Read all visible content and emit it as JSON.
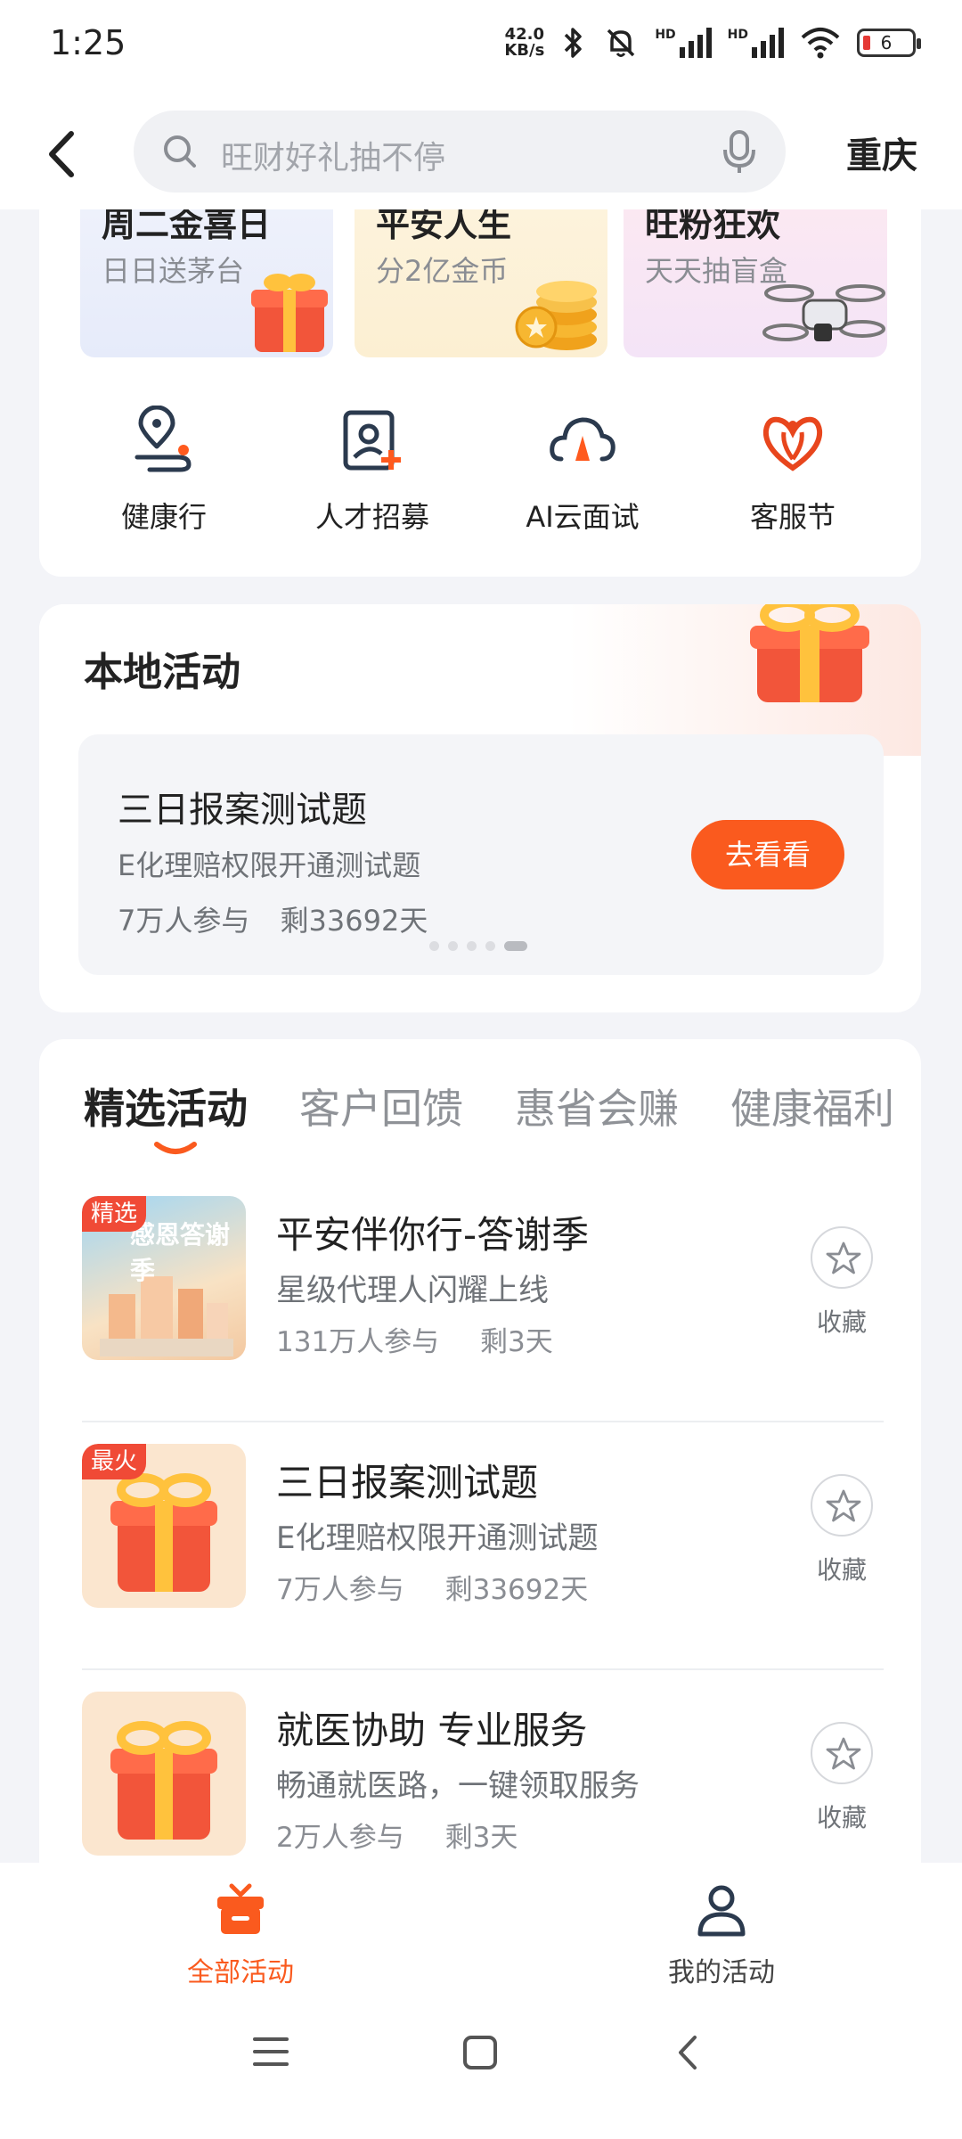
{
  "status_bar": {
    "time": "1:25",
    "net_speed_value": "42.0",
    "net_speed_unit": "KB/s",
    "hd1": "HD",
    "hd2": "HD",
    "battery": "6"
  },
  "header": {
    "search_placeholder": "旺财好礼抽不停",
    "city": "重庆"
  },
  "banners": [
    {
      "title": "周二金喜日",
      "subtitle": "日日送茅台"
    },
    {
      "title": "平安人生",
      "subtitle": "分2亿金币"
    },
    {
      "title": "旺粉狂欢",
      "subtitle": "天天抽盲盒"
    }
  ],
  "quick_links": [
    {
      "label": "健康行",
      "icon": "location-route-icon"
    },
    {
      "label": "人才招募",
      "icon": "recruit-icon"
    },
    {
      "label": "AI云面试",
      "icon": "cloud-icon"
    },
    {
      "label": "客服节",
      "icon": "heart-flower-icon"
    }
  ],
  "local_activities": {
    "title": "本地活动",
    "card": {
      "title": "三日报案测试题",
      "subtitle": "E化理赔权限开通测试题",
      "participants": "7万人参与",
      "remaining": "剩33692天",
      "button": "去看看"
    },
    "pager": {
      "count": 5,
      "active": 4
    }
  },
  "featured": {
    "tabs": [
      "精选活动",
      "客户回馈",
      "惠省会赚",
      "健康福利"
    ],
    "active_tab": 0,
    "items": [
      {
        "badge": "精选",
        "title": "平安伴你行-答谢季",
        "subtitle": "星级代理人闪耀上线",
        "participants": "131万人参与",
        "remaining": "剩3天",
        "fav_label": "收藏",
        "thumb_text": "感恩答谢季"
      },
      {
        "badge": "最火",
        "title": "三日报案测试题",
        "subtitle": "E化理赔权限开通测试题",
        "participants": "7万人参与",
        "remaining": "剩33692天",
        "fav_label": "收藏"
      },
      {
        "badge": "",
        "title": "就医协助 专业服务",
        "subtitle": "畅通就医路，一键领取服务",
        "participants": "2万人参与",
        "remaining": "剩3天",
        "fav_label": "收藏"
      }
    ]
  },
  "bottom_nav": [
    {
      "label": "全部活动",
      "active": true
    },
    {
      "label": "我的活动",
      "active": false
    }
  ],
  "colors": {
    "accent": "#fa5a1e",
    "badge": "#f04a36",
    "text": "#222222",
    "muted": "#8a8d93"
  }
}
